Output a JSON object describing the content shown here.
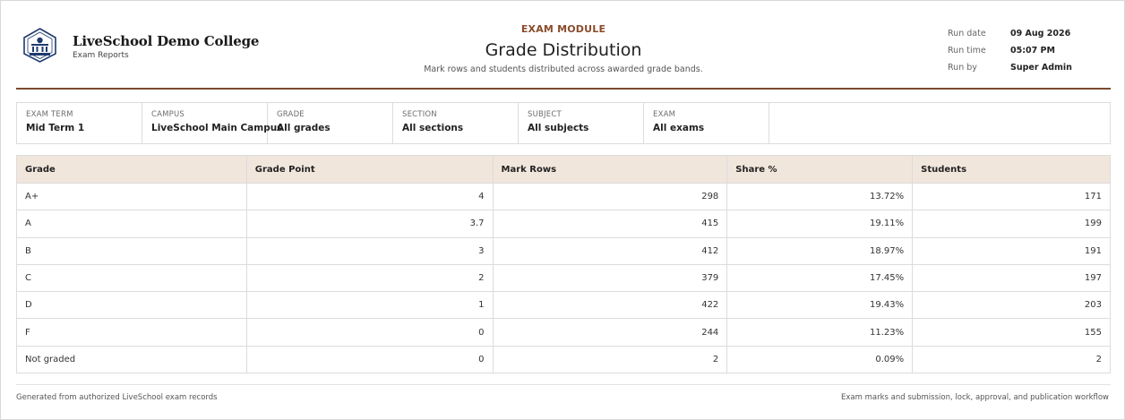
{
  "header": {
    "college_name": "LiveSchool Demo College",
    "college_sub": "Exam Reports",
    "module": "EXAM MODULE",
    "title": "Grade Distribution",
    "subtitle": "Mark rows and students distributed across awarded grade bands.",
    "logo_icon": "college-crest-icon",
    "accent_color": "#7b4a2e",
    "module_color": "#8a4b2a"
  },
  "meta": [
    {
      "label": "Run date",
      "value": "09 Aug 2026"
    },
    {
      "label": "Run time",
      "value": "05:07 PM"
    },
    {
      "label": "Run by",
      "value": "Super Admin"
    }
  ],
  "filters": [
    {
      "label": "EXAM TERM",
      "value": "Mid Term 1"
    },
    {
      "label": "CAMPUS",
      "value": "LiveSchool Main Campus"
    },
    {
      "label": "GRADE",
      "value": "All grades"
    },
    {
      "label": "SECTION",
      "value": "All sections"
    },
    {
      "label": "SUBJECT",
      "value": "All subjects"
    },
    {
      "label": "EXAM",
      "value": "All exams"
    }
  ],
  "table": {
    "header_bg": "#f1e6dc",
    "columns": [
      "Grade",
      "Grade Point",
      "Mark Rows",
      "Share %",
      "Students"
    ],
    "rows": [
      [
        "A+",
        "4",
        "298",
        "13.72%",
        "171"
      ],
      [
        "A",
        "3.7",
        "415",
        "19.11%",
        "199"
      ],
      [
        "B",
        "3",
        "412",
        "18.97%",
        "191"
      ],
      [
        "C",
        "2",
        "379",
        "17.45%",
        "197"
      ],
      [
        "D",
        "1",
        "422",
        "19.43%",
        "203"
      ],
      [
        "F",
        "0",
        "244",
        "11.23%",
        "155"
      ],
      [
        "Not graded",
        "0",
        "2",
        "0.09%",
        "2"
      ]
    ]
  },
  "footer": {
    "left": "Generated from authorized LiveSchool exam records",
    "right": "Exam marks and submission, lock, approval, and publication workflow"
  }
}
